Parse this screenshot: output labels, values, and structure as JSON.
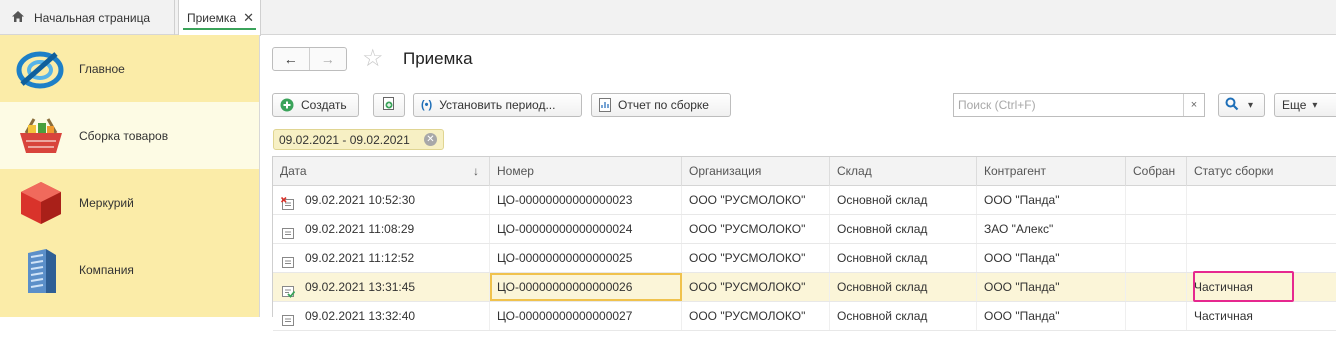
{
  "tabs": {
    "home_label": "Начальная страница",
    "active_label": "Приемка",
    "close_glyph": "✕"
  },
  "sidebar": {
    "items": [
      {
        "label": "Главное",
        "icon": "main-logo-icon"
      },
      {
        "label": "Сборка товаров",
        "icon": "basket-icon"
      },
      {
        "label": "Меркурий",
        "icon": "red-cube-icon"
      },
      {
        "label": "Компания",
        "icon": "building-icon"
      }
    ],
    "active_index": 1
  },
  "page": {
    "title": "Приемка",
    "back_glyph": "←",
    "forward_glyph": "→",
    "star_glyph": "☆"
  },
  "toolbar": {
    "create_label": "Создать",
    "period_label": "Установить период...",
    "report_label": "Отчет по сборке",
    "more_label": "Еще",
    "dropdown_glyph": "▾"
  },
  "search": {
    "placeholder": "Поиск (Ctrl+F)",
    "clear_glyph": "×"
  },
  "filter": {
    "label": "09.02.2021 - 09.02.2021"
  },
  "table": {
    "columns": [
      "Дата",
      "Номер",
      "Организация",
      "Склад",
      "Контрагент",
      "Собран",
      "Статус сборки"
    ],
    "sort_glyph": "↓",
    "rows": [
      {
        "date": "09.02.2021 10:52:30",
        "number": "ЦО-00000000000000023",
        "org": "ООО \"РУСМОЛОКО\"",
        "warehouse": "Основной склад",
        "contractor": "ООО \"Панда\"",
        "collected": "",
        "status": "",
        "icon": "doc-deleted-icon"
      },
      {
        "date": "09.02.2021 11:08:29",
        "number": "ЦО-00000000000000024",
        "org": "ООО \"РУСМОЛОКО\"",
        "warehouse": "Основной склад",
        "contractor": "ЗАО \"Алекс\"",
        "collected": "",
        "status": "",
        "icon": "doc-icon"
      },
      {
        "date": "09.02.2021 11:12:52",
        "number": "ЦО-00000000000000025",
        "org": "ООО \"РУСМОЛОКО\"",
        "warehouse": "Основной склад",
        "contractor": "ООО \"Панда\"",
        "collected": "",
        "status": "",
        "icon": "doc-icon"
      },
      {
        "date": "09.02.2021 13:31:45",
        "number": "ЦО-00000000000000026",
        "org": "ООО \"РУСМОЛОКО\"",
        "warehouse": "Основной склад",
        "contractor": "ООО \"Панда\"",
        "collected": "",
        "status": "Частичная",
        "icon": "doc-posted-icon"
      },
      {
        "date": "09.02.2021 13:32:40",
        "number": "ЦО-00000000000000027",
        "org": "ООО \"РУСМОЛОКО\"",
        "warehouse": "Основной склад",
        "contractor": "ООО \"Панда\"",
        "collected": "",
        "status": "Частичная",
        "icon": "doc-icon"
      }
    ],
    "selected_row": 3
  }
}
